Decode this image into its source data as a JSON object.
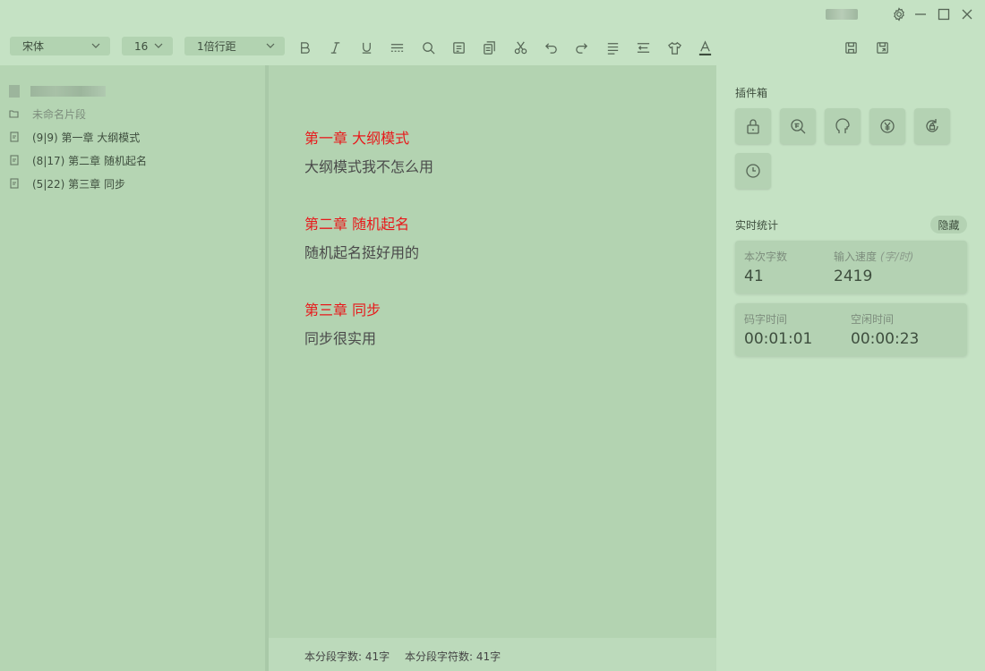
{
  "toolbar": {
    "font_family": "宋体",
    "font_size": "16",
    "line_spacing": "1倍行距"
  },
  "tree": {
    "folder_label": "未命名片段",
    "items": [
      {
        "label": "(9|9) 第一章 大纲模式"
      },
      {
        "label": "(8|17) 第二章 随机起名"
      },
      {
        "label": "(5|22) 第三章 同步"
      }
    ]
  },
  "editor": {
    "chapters": [
      {
        "title": "第一章  大纲模式",
        "body": "大纲模式我不怎么用"
      },
      {
        "title": "第二章  随机起名",
        "body": "随机起名挺好用的"
      },
      {
        "title": "第三章  同步",
        "body": "同步很实用"
      }
    ]
  },
  "status": {
    "segment_words": "本分段字数: 41字",
    "segment_chars": "本分段字符数: 41字"
  },
  "plugins": {
    "title": "插件箱",
    "icons": [
      "lock-icon",
      "word-search-icon",
      "head-icon",
      "yuan-icon",
      "lock-refresh-icon",
      "clock-icon"
    ]
  },
  "stats": {
    "title": "实时统计",
    "hide_label": "隐藏",
    "count_label": "本次字数",
    "count_value": "41",
    "speed_label": "输入速度",
    "speed_unit": "(字/时)",
    "speed_value": "2419",
    "typing_time_label": "码字时间",
    "typing_time_value": "00:01:01",
    "idle_time_label": "空闲时间",
    "idle_time_value": "00:00:23"
  }
}
